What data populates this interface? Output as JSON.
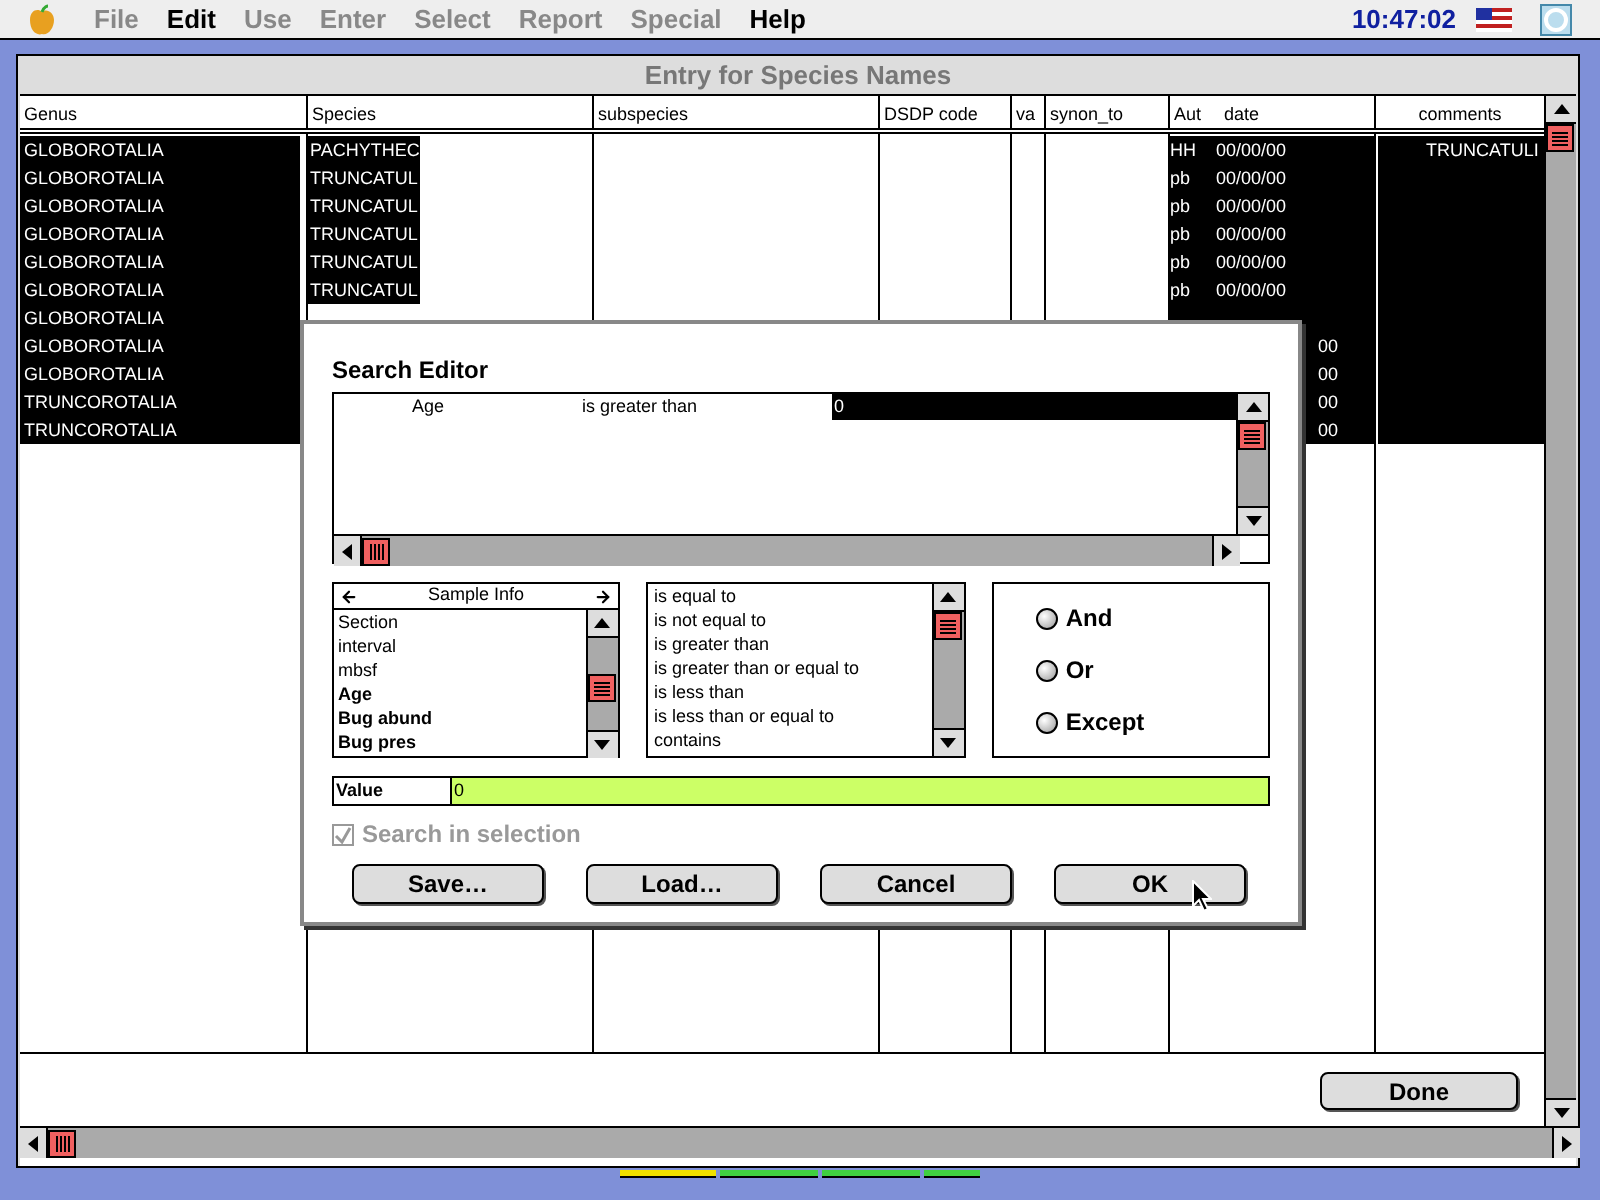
{
  "menu_bar": {
    "items": [
      {
        "label": "File",
        "disabled": true
      },
      {
        "label": "Edit",
        "disabled": false
      },
      {
        "label": "Use",
        "disabled": true
      },
      {
        "label": "Enter",
        "disabled": true
      },
      {
        "label": "Select",
        "disabled": true
      },
      {
        "label": "Report",
        "disabled": true
      },
      {
        "label": "Special",
        "disabled": true
      },
      {
        "label": "Help",
        "disabled": false
      }
    ],
    "clock": "10:47:02"
  },
  "window": {
    "title": "Entry for Species Names"
  },
  "table": {
    "columns": [
      "Genus",
      "Species",
      "subspecies",
      "DSDP code",
      "va",
      "synon_to",
      "Aut",
      "date",
      "comments"
    ],
    "rows": [
      {
        "genus": "GLOBOROTALIA",
        "species": "PACHYTHEC",
        "aut": "HH",
        "date": "00/00/00",
        "comments": "TRUNCATULI",
        "selected": true
      },
      {
        "genus": "GLOBOROTALIA",
        "species": "TRUNCATUL",
        "aut": "pb",
        "date": "00/00/00",
        "selected": true
      },
      {
        "genus": "GLOBOROTALIA",
        "species": "TRUNCATUL",
        "aut": "pb",
        "date": "00/00/00",
        "selected": true
      },
      {
        "genus": "GLOBOROTALIA",
        "species": "TRUNCATUL",
        "aut": "pb",
        "date": "00/00/00",
        "selected": true
      },
      {
        "genus": "GLOBOROTALIA",
        "species": "TRUNCATUL",
        "aut": "pb",
        "date": "00/00/00",
        "selected": true
      },
      {
        "genus": "GLOBOROTALIA",
        "species": "TRUNCATUL",
        "aut": "pb",
        "date": "00/00/00",
        "selected": true
      },
      {
        "genus": "GLOBOROTALIA",
        "selected": true
      },
      {
        "genus": "GLOBOROTALIA",
        "date_end": "00",
        "selected": true
      },
      {
        "genus": "GLOBOROTALIA",
        "date_end": "00",
        "selected": true
      },
      {
        "genus": "TRUNCOROTALIA",
        "date_end": "00",
        "selected": true
      },
      {
        "genus": "TRUNCOROTALIA",
        "date_end": "00",
        "selected": true
      }
    ]
  },
  "done_button": "Done",
  "search_editor": {
    "title": "Search Editor",
    "criteria": [
      {
        "field": "Age",
        "operator": "is greater than",
        "value": "0",
        "selected": true
      }
    ],
    "field_list": {
      "title": "Sample Info",
      "items": [
        {
          "label": "Section",
          "bold": false
        },
        {
          "label": "interval",
          "bold": false
        },
        {
          "label": "mbsf",
          "bold": false
        },
        {
          "label": "Age",
          "bold": true
        },
        {
          "label": "Bug abund",
          "bold": true
        },
        {
          "label": "Bug pres",
          "bold": true
        }
      ]
    },
    "operators": [
      "is equal to",
      "is not equal to",
      "is greater than",
      "is greater than or equal to",
      "is less than",
      "is less than or equal to",
      "contains"
    ],
    "conjunctions": [
      {
        "label": "And",
        "selected": false
      },
      {
        "label": "Or",
        "selected": false
      },
      {
        "label": "Except",
        "selected": false
      }
    ],
    "value": {
      "label": "Value",
      "value": "0"
    },
    "search_in_selection": {
      "label": "Search in selection",
      "checked": true,
      "disabled": true
    },
    "buttons": [
      "Save…",
      "Load…",
      "Cancel",
      "OK"
    ]
  }
}
